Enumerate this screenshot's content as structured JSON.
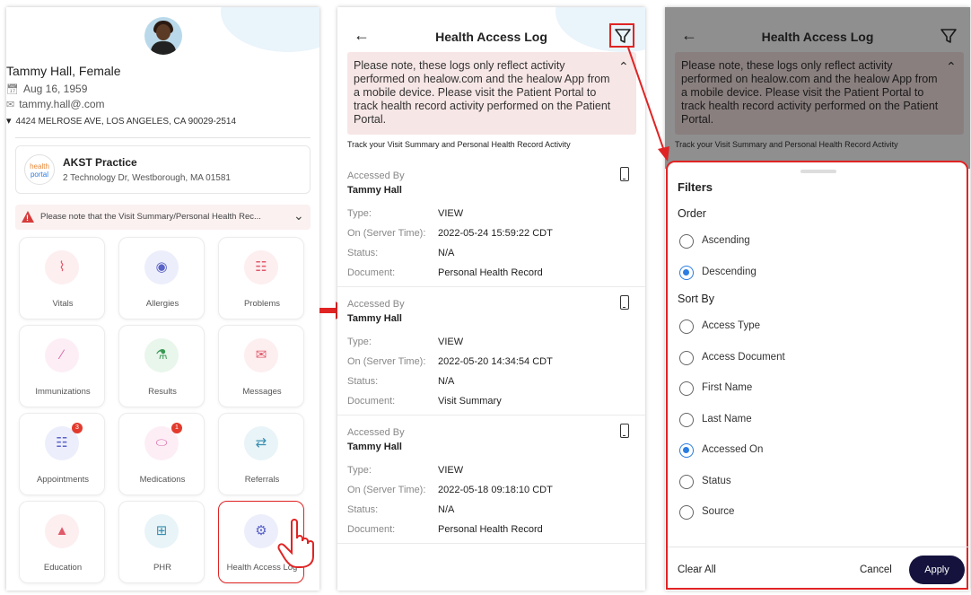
{
  "colors": {
    "accent_red": "#e02424",
    "primary_button": "#15133d",
    "radio_selected": "#2a7de1",
    "notice_bg": "#f7e6e6"
  },
  "home": {
    "profile": {
      "name": "Tammy Hall, Female",
      "dob": "Aug 16, 1959",
      "email": "tammy.hall@.com",
      "address": "4424 MELROSE AVE, LOS ANGELES, CA 90029-2514"
    },
    "practice": {
      "logo_text_1": "health",
      "logo_text_2": "portal",
      "name": "AKST Practice",
      "address": "2 Technology Dr, Westborough, MA 01581"
    },
    "warning": "Please note that the Visit Summary/Personal Health Rec...",
    "tiles": [
      {
        "label": "Vitals",
        "icon": "vitals-icon",
        "glyph": "⌇"
      },
      {
        "label": "Allergies",
        "icon": "allergies-icon",
        "glyph": "◉"
      },
      {
        "label": "Problems",
        "icon": "problems-icon",
        "glyph": "☷"
      },
      {
        "label": "Immunizations",
        "icon": "syringe-icon",
        "glyph": "∕"
      },
      {
        "label": "Results",
        "icon": "flask-icon",
        "glyph": "⚗"
      },
      {
        "label": "Messages",
        "icon": "envelope-icon",
        "glyph": "✉"
      },
      {
        "label": "Appointments",
        "icon": "calendar-icon",
        "glyph": "☷",
        "badge": "3"
      },
      {
        "label": "Medications",
        "icon": "pill-icon",
        "glyph": "⬭",
        "badge": "1"
      },
      {
        "label": "Referrals",
        "icon": "referrals-icon",
        "glyph": "⇄"
      },
      {
        "label": "Education",
        "icon": "graduation-cap-icon",
        "glyph": "▲"
      },
      {
        "label": "PHR",
        "icon": "phr-icon",
        "glyph": "⊞"
      },
      {
        "label": "Health Access Log",
        "icon": "health-access-log-icon",
        "glyph": "⚙"
      }
    ]
  },
  "log": {
    "title": "Health Access Log",
    "notice": "Please note, these logs only reflect activity performed on healow.com and the healow App from a mobile device.  Please visit the Patient Portal to track health record activity performed on the Patient Portal.",
    "track_text": "Track your Visit Summary and Personal Health Record Activity",
    "labels": {
      "accessed_by": "Accessed By",
      "type": "Type:",
      "on": "On (Server Time):",
      "status": "Status:",
      "document": "Document:"
    },
    "entries": [
      {
        "who": "Tammy Hall",
        "type": "VIEW",
        "on": "2022-05-24 15:59:22 CDT",
        "status": "N/A",
        "document": "Personal Health Record"
      },
      {
        "who": "Tammy Hall",
        "type": "VIEW",
        "on": "2022-05-20 14:34:54 CDT",
        "status": "N/A",
        "document": "Visit Summary"
      },
      {
        "who": "Tammy Hall",
        "type": "VIEW",
        "on": "2022-05-18  09:18:10 CDT",
        "status": "N/A",
        "document": "Personal Health Record"
      }
    ]
  },
  "filters": {
    "title": "Filters",
    "order_heading": "Order",
    "sort_heading": "Sort By",
    "order_options": [
      {
        "label": "Ascending",
        "selected": false
      },
      {
        "label": "Descending",
        "selected": true
      }
    ],
    "sort_options": [
      {
        "label": "Access Type",
        "selected": false
      },
      {
        "label": "Access Document",
        "selected": false
      },
      {
        "label": "First Name",
        "selected": false
      },
      {
        "label": "Last Name",
        "selected": false
      },
      {
        "label": "Accessed On",
        "selected": true
      },
      {
        "label": "Status",
        "selected": false
      },
      {
        "label": "Source",
        "selected": false
      }
    ],
    "clear_all": "Clear All",
    "cancel": "Cancel",
    "apply": "Apply"
  }
}
